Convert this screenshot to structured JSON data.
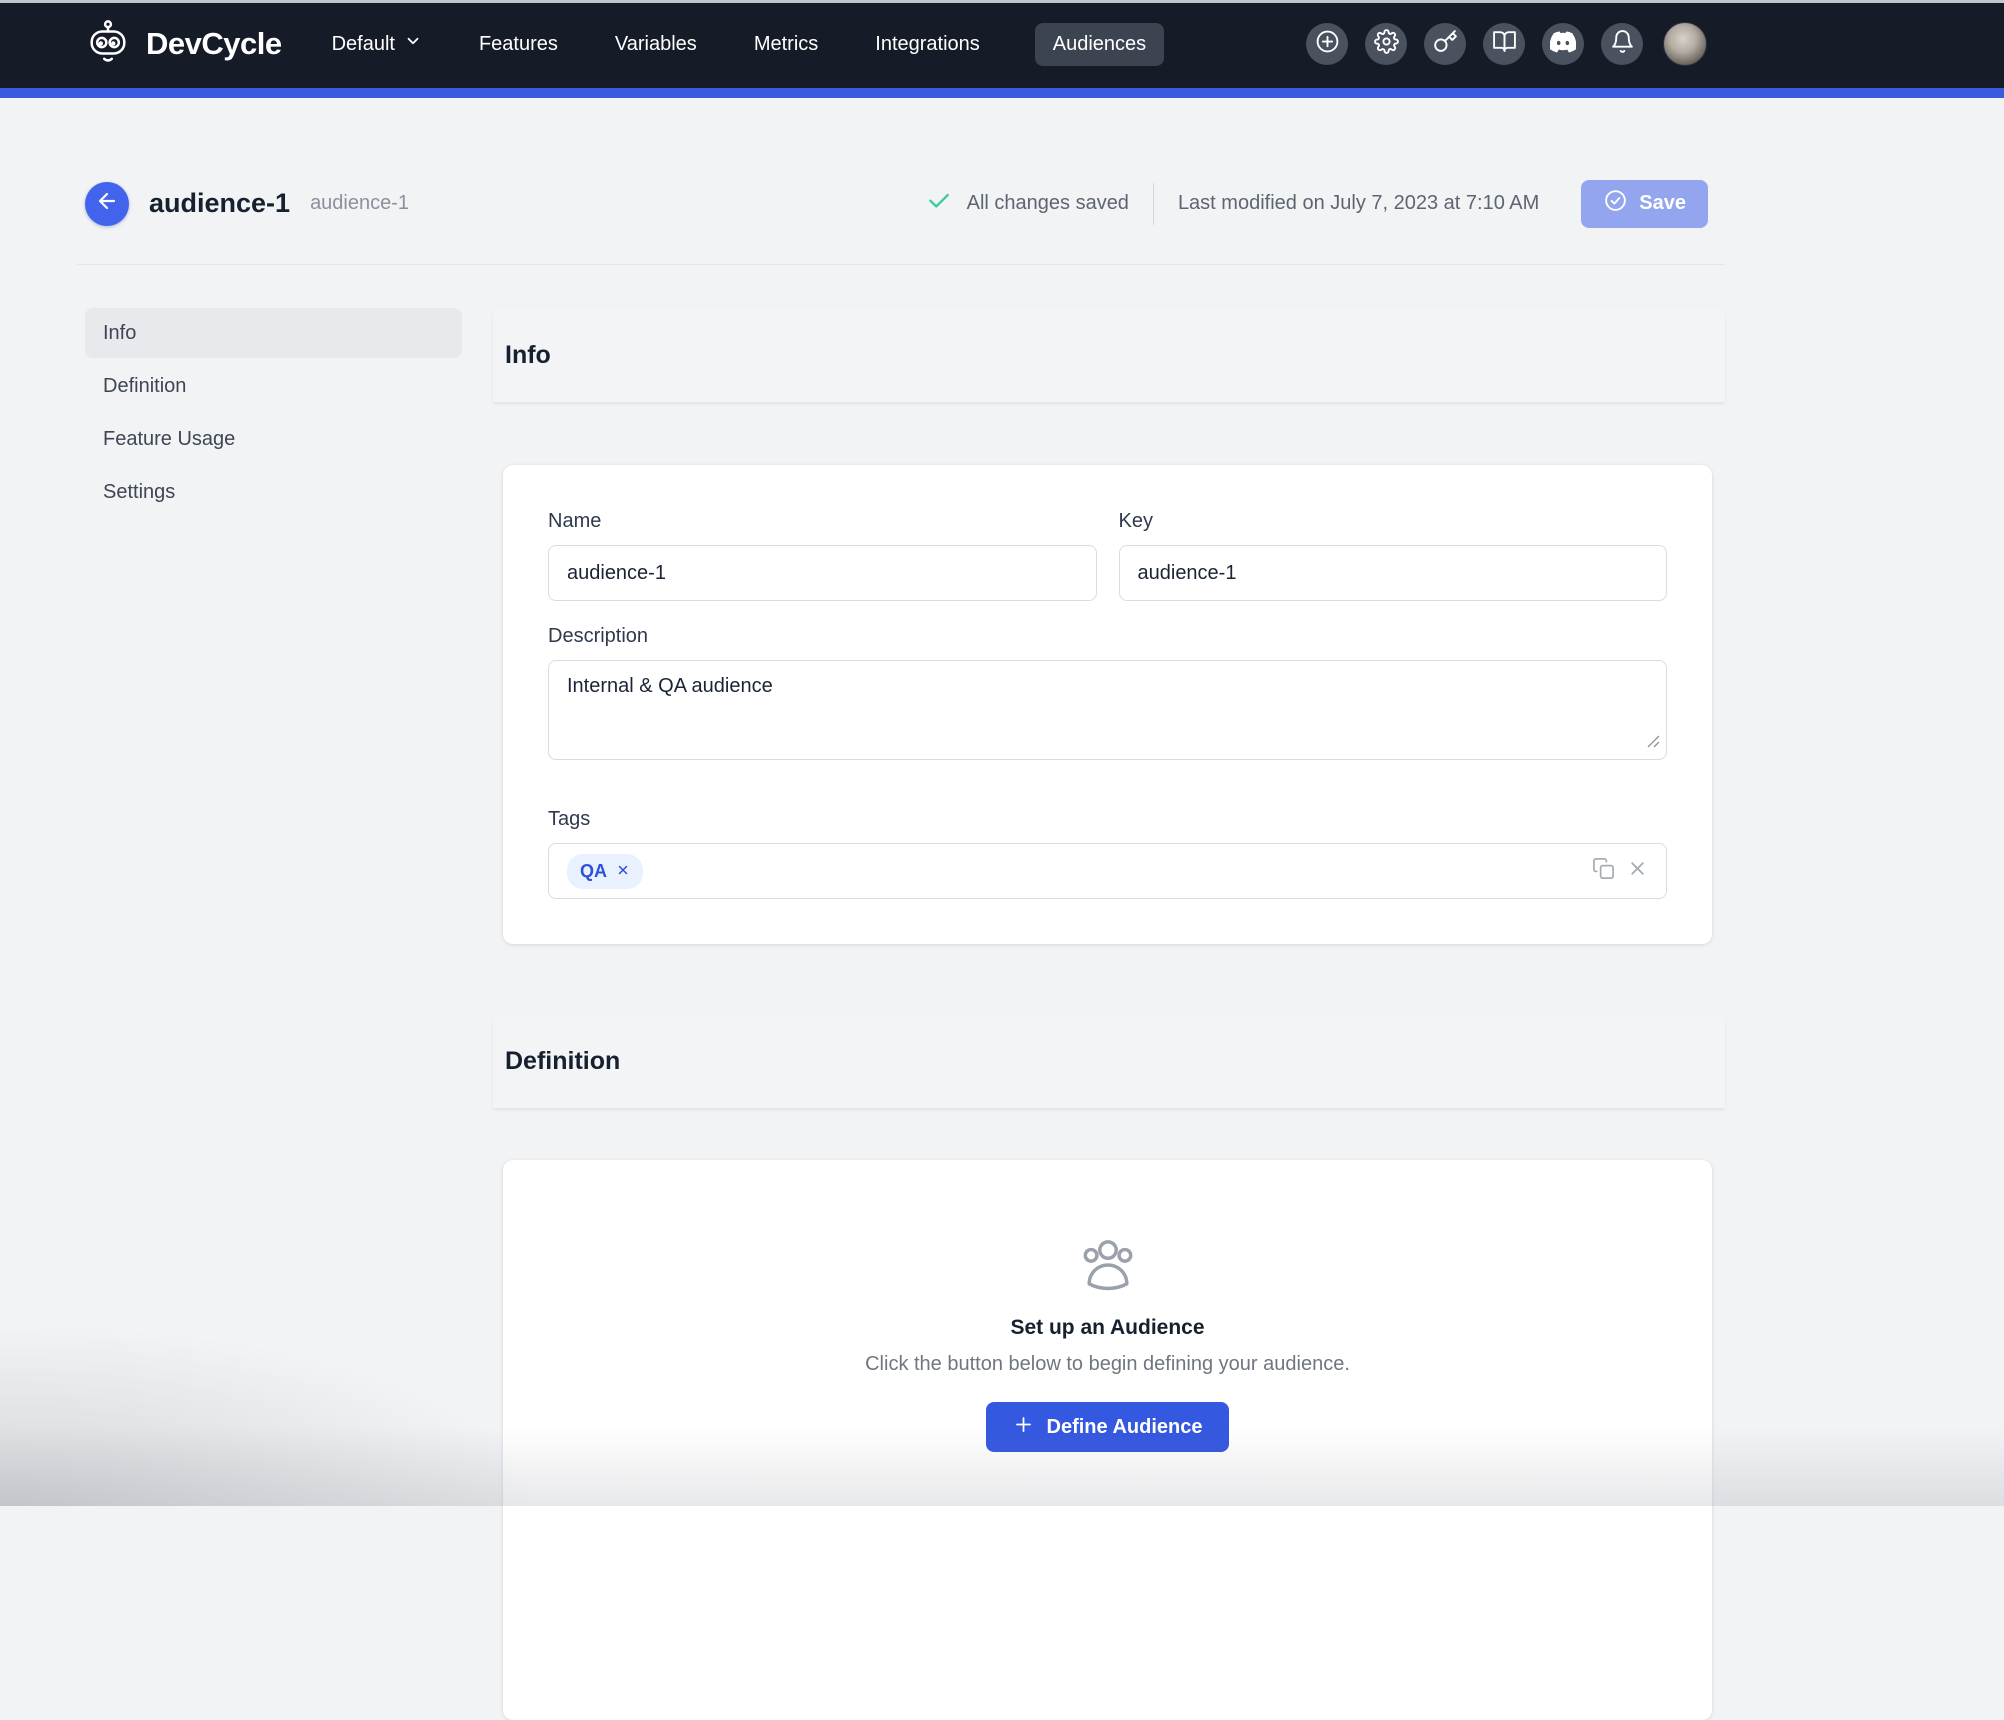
{
  "navbar": {
    "brand": "DevCycle",
    "items": [
      {
        "label": "Default",
        "dropdown": true
      },
      {
        "label": "Features"
      },
      {
        "label": "Variables"
      },
      {
        "label": "Metrics"
      },
      {
        "label": "Integrations"
      },
      {
        "label": "Audiences",
        "active": true
      }
    ],
    "action_icons": [
      "plus-circle",
      "gear",
      "key",
      "book-open",
      "discord",
      "bell"
    ]
  },
  "header": {
    "title": "audience-1",
    "subtitle": "audience-1",
    "saved_status": "All changes saved",
    "last_modified": "Last modified on July 7, 2023 at 7:10 AM",
    "save_button": "Save"
  },
  "sidebar": {
    "items": [
      {
        "label": "Info",
        "active": true
      },
      {
        "label": "Definition"
      },
      {
        "label": "Feature Usage"
      },
      {
        "label": "Settings"
      }
    ]
  },
  "info": {
    "heading": "Info",
    "name_label": "Name",
    "name_value": "audience-1",
    "key_label": "Key",
    "key_value": "audience-1",
    "description_label": "Description",
    "description_value": "Internal & QA audience",
    "tags_label": "Tags",
    "tags": [
      {
        "label": "QA"
      }
    ]
  },
  "definition": {
    "heading": "Definition",
    "empty_title": "Set up an Audience",
    "empty_subtitle": "Click the button below to begin defining your audience.",
    "define_button": "Define Audience"
  },
  "colors": {
    "navbar_bg": "#151b27",
    "strip_blue": "#3a5ae0",
    "accent_blue": "#3558e0",
    "back_button_blue": "#4263eb",
    "save_disabled_blue": "#92a5ee",
    "page_bg": "#f1f3f5",
    "tag_chip_bg": "#e9f1fe",
    "tag_chip_text": "#2c50da",
    "saved_check_green": "#3ec9a7"
  }
}
